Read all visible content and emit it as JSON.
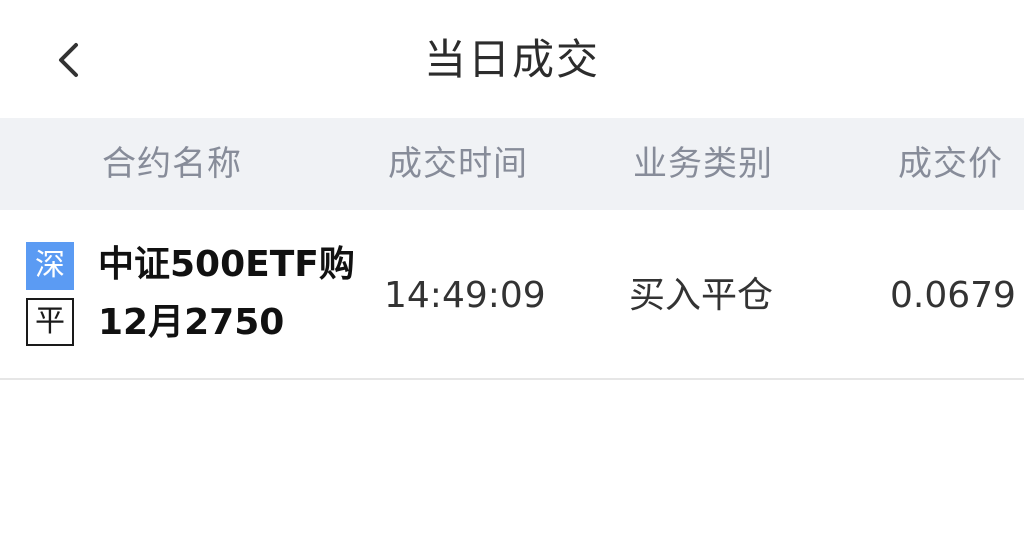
{
  "navbar": {
    "back_icon": "chevron-left-icon",
    "title": "当日成交"
  },
  "table": {
    "columns": [
      "合约名称",
      "成交时间",
      "业务类别",
      "成交价"
    ],
    "rows": [
      {
        "exchange_tag": "深",
        "action_tag": "平",
        "contract_name": "中证500ETF购",
        "contract_sub": "12月2750",
        "time": "14:49:09",
        "type": "买入平仓",
        "price": "0.0679"
      }
    ]
  },
  "colors": {
    "header_bg": "#f0f2f5",
    "exchange_tag_bg": "#5b9bf3",
    "header_text": "#878c99"
  }
}
